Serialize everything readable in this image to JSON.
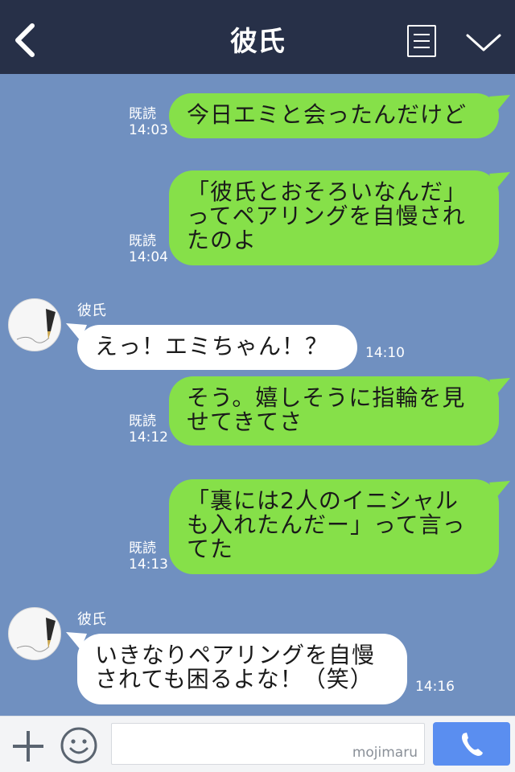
{
  "header": {
    "title": "彼氏",
    "back_icon": "chevron-left-icon",
    "menu_icon": "list-icon",
    "collapse_icon": "chevron-down-icon"
  },
  "messages": [
    {
      "direction": "sent",
      "lines": [
        "今日エミと会ったんだけど"
      ],
      "read_label": "既読",
      "time": "14:03"
    },
    {
      "direction": "sent",
      "lines": [
        "「彼氏とおそろいなんだ」",
        "ってペアリングを自慢され",
        "たのよ"
      ],
      "read_label": "既読",
      "time": "14:04"
    },
    {
      "direction": "received",
      "sender": "彼氏",
      "lines": [
        "えっ！エミちゃん！？"
      ],
      "time": "14:10"
    },
    {
      "direction": "sent",
      "lines": [
        "そう。嬉しそうに指輪を見",
        "せてきてさ"
      ],
      "read_label": "既読",
      "time": "14:12"
    },
    {
      "direction": "sent",
      "lines": [
        "「裏には2人のイニシャル",
        "も入れたんだー」って言っ",
        "てた"
      ],
      "read_label": "既読",
      "time": "14:13"
    },
    {
      "direction": "received",
      "sender": "彼氏",
      "lines": [
        "いきなりペアリングを自慢",
        "されても困るよな！（笑）"
      ],
      "time": "14:16"
    }
  ],
  "footer": {
    "add_icon": "plus-icon",
    "emoji_icon": "smiley-icon",
    "input_value": "",
    "watermark": "mojimaru",
    "call_icon": "phone-icon"
  },
  "colors": {
    "header_bg": "#273048",
    "chat_bg": "#7090c0",
    "sent_bubble": "#86e049",
    "received_bubble": "#ffffff",
    "call_button": "#5a8ef0"
  }
}
